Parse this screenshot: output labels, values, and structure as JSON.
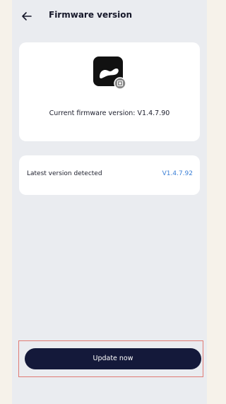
{
  "header": {
    "title": "Firmware version",
    "back_icon": "arrow-left-icon"
  },
  "firmware_card": {
    "icon": "device-chip-icon",
    "current_label": "Current firmware version:",
    "current_value": "V1.4.7.90"
  },
  "latest_card": {
    "label": "Latest version detected",
    "value": "V1.4.7.92"
  },
  "actions": {
    "update_label": "Update now"
  },
  "colors": {
    "screen_bg": "#eaecf0",
    "card_bg": "#ffffff",
    "primary_button": "#14193a",
    "link_blue": "#3b7fd6",
    "highlight_border": "#e07b74"
  }
}
